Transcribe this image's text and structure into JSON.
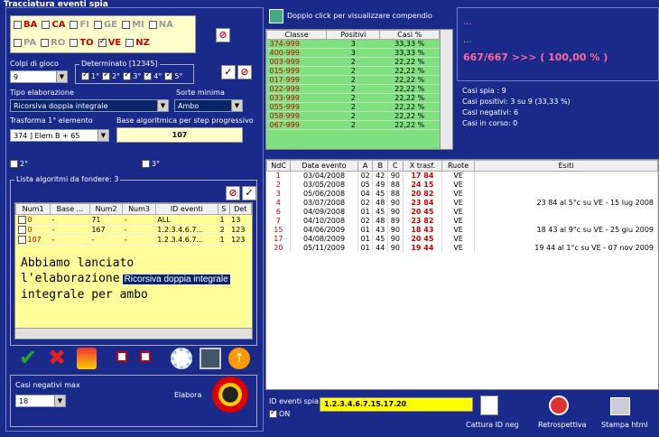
{
  "window_title": "Tracciatura eventi spia",
  "wheels_row1": [
    {
      "label": "BA",
      "on": false,
      "red": true
    },
    {
      "label": "CA",
      "on": false,
      "red": true
    },
    {
      "label": "FI",
      "on": false,
      "red": false
    },
    {
      "label": "GE",
      "on": false,
      "red": false
    },
    {
      "label": "MI",
      "on": false,
      "red": false
    },
    {
      "label": "NA",
      "on": false,
      "red": false
    }
  ],
  "wheels_row2": [
    {
      "label": "PA",
      "on": false,
      "red": false
    },
    {
      "label": "RO",
      "on": false,
      "red": false
    },
    {
      "label": "TO",
      "on": false,
      "red": true
    },
    {
      "label": "VE",
      "on": true,
      "red": true
    },
    {
      "label": "NZ",
      "on": false,
      "red": true
    }
  ],
  "colpi": {
    "label": "Colpi di gioco",
    "value": "9"
  },
  "determinato": {
    "label": "Determinato [12345]",
    "items": [
      "1°",
      "2°",
      "3°",
      "4°",
      "5°"
    ]
  },
  "tipo": {
    "label": "Tipo elaborazione",
    "value": "Ricorsiva doppia integrale"
  },
  "sorte": {
    "label": "Sorte minima",
    "value": "Ambo"
  },
  "trasforma": {
    "label": "Trasforma 1° elemento",
    "value": "374 ] Elem B + 65"
  },
  "base_alg": {
    "label": "Base algoritmica per step progressivo",
    "value": "107"
  },
  "chk2": "2°",
  "chk3": "3°",
  "lista": {
    "label": "Lista algoritmi da fondere: 3",
    "headers": [
      "Num1",
      "Base ...",
      "Num2",
      "Num3",
      "ID eventi",
      "S",
      "Det"
    ],
    "rows": [
      [
        "0",
        "-",
        "71",
        "-",
        "ALL",
        "1",
        "13"
      ],
      [
        "0",
        "-",
        "167",
        "-",
        "1.2.3.4.6.7...",
        "2",
        "123"
      ],
      [
        "107",
        "-",
        "-",
        "-",
        "1.2.3.4.6.7...",
        "1",
        "123"
      ]
    ]
  },
  "overlay": {
    "line1": "Abbiamo lanciato",
    "line2": "l'elaborazione",
    "tooltip": "Ricorsiva doppia integrale",
    "line3": "integrale per ambo"
  },
  "casi_neg": {
    "label": "Casi negativi max",
    "value": "18"
  },
  "elabora": "Elabora",
  "compendio_hint": "Doppio click per visualizzare compendio",
  "classi": {
    "headers": [
      "Classe",
      "Positivi",
      "Casi %"
    ],
    "rows": [
      [
        "374-999",
        "3",
        "33,33 %"
      ],
      [
        "400-999",
        "3",
        "33,33 %"
      ],
      [
        "003-999",
        "2",
        "22,22 %"
      ],
      [
        "015-999",
        "2",
        "22,22 %"
      ],
      [
        "017-999",
        "2",
        "22,22 %"
      ],
      [
        "022-999",
        "2",
        "22,22 %"
      ],
      [
        "033-999",
        "2",
        "22,22 %"
      ],
      [
        "055-999",
        "2",
        "22,22 %"
      ],
      [
        "058-999",
        "2",
        "22,22 %"
      ],
      [
        "067-999",
        "2",
        "22,22 %"
      ]
    ]
  },
  "summary": {
    "dots1": "...",
    "dots2": "...",
    "ratio": "667/667 >>> ( 100,00 % )"
  },
  "stats": [
    "Casi spia : 9",
    "Casi positivi: 3 su 9 (33,33 %)",
    "Casi negativi: 6",
    "Casi in corso: 0"
  ],
  "eventi": {
    "headers": [
      "NdC",
      "Data evento",
      "A",
      "B",
      "C",
      "X trasf.",
      "Ruote",
      "Esiti"
    ],
    "rows": [
      [
        "1",
        "03/04/2008",
        "02",
        "42",
        "90",
        "17 84",
        "VE",
        ""
      ],
      [
        "2",
        "03/05/2008",
        "05",
        "49",
        "88",
        "24 15",
        "VE",
        ""
      ],
      [
        "3",
        "05/06/2008",
        "04",
        "45",
        "88",
        "20 82",
        "VE",
        ""
      ],
      [
        "4",
        "03/07/2008",
        "02",
        "48",
        "90",
        "23 84",
        "VE",
        "23 84 al 5°c su VE - 15 lug 2008"
      ],
      [
        "6",
        "04/09/2008",
        "01",
        "45",
        "90",
        "20 45",
        "VE",
        ""
      ],
      [
        "7",
        "04/10/2008",
        "02",
        "48",
        "89",
        "23 82",
        "VE",
        ""
      ],
      [
        "15",
        "04/06/2009",
        "01",
        "43",
        "90",
        "18 43",
        "VE",
        "18 43 al 9°c su VE - 25 giu 2009"
      ],
      [
        "17",
        "04/08/2009",
        "01",
        "45",
        "90",
        "20 45",
        "VE",
        ""
      ],
      [
        "20",
        "05/11/2009",
        "01",
        "44",
        "90",
        "19 44",
        "VE",
        "19 44 al 1°c su VE - 07 nov 2009"
      ]
    ]
  },
  "id_eventi": {
    "label": "ID eventi spia",
    "value": "1.2.3.4.6.7.15.17.20",
    "on_label": "ON"
  },
  "bottom_buttons": {
    "cattura": "Cattura ID neg",
    "retro": "Retrospettiva",
    "stampa": "Stampa html"
  }
}
